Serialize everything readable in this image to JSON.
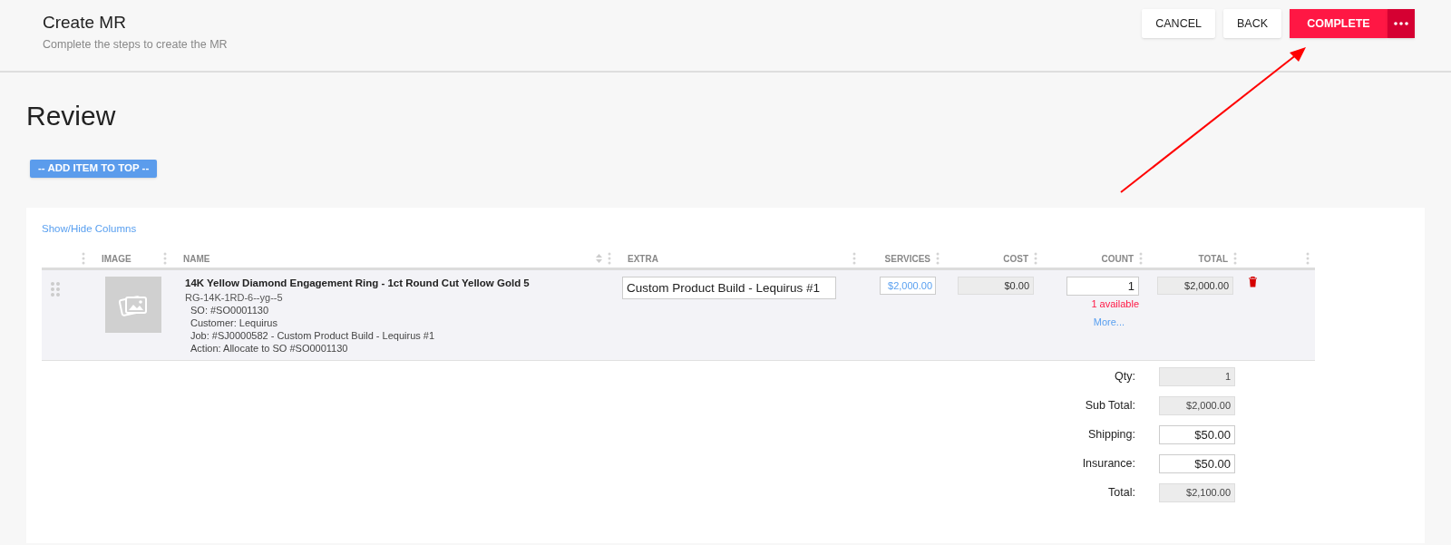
{
  "header": {
    "title": "Create MR",
    "subtitle": "Complete the steps to create the MR"
  },
  "actions": [
    {
      "label": "CANCEL",
      "kind": "plain"
    },
    {
      "label": "BACK",
      "kind": "plain"
    },
    {
      "label": "COMPLETE",
      "kind": "primary"
    }
  ],
  "section_title": "Review",
  "add_button": "-- ADD ITEM TO TOP --",
  "table": {
    "toggle_link": "Show/Hide Columns",
    "columns": [
      {
        "sortable": false
      },
      {
        "label": "IMAGE",
        "sortable": false
      },
      {
        "label": "NAME",
        "sortable": true
      },
      {
        "label": "EXTRA",
        "sortable": false
      },
      {
        "label": "SERVICES",
        "sortable": false
      },
      {
        "label": "COST",
        "sortable": false
      },
      {
        "label": "COUNT",
        "sortable": false
      },
      {
        "label": "TOTAL",
        "sortable": false
      },
      {
        "sortable": false
      }
    ],
    "rows": [
      {
        "name": "14K Yellow Diamond Engagement Ring - 1ct Round Cut Yellow Gold 5",
        "sku": "RG-14K-1RD-6--yg--5",
        "details": [
          "SO: #SO0001130",
          "Customer: Lequirus",
          "Job: #SJ0000582 - Custom Product Build - Lequirus #1",
          "Action: Allocate to SO #SO0001130"
        ],
        "extra": "Custom Product Build - Lequirus #1",
        "services": "$2,000.00",
        "cost": "$0.00",
        "count": "1",
        "availability": "1 available",
        "more_link": "More...",
        "total": "$2,000.00"
      }
    ]
  },
  "summary": [
    {
      "label": "Qty:",
      "value": "1",
      "disabled": true
    },
    {
      "label": "Sub Total:",
      "value": "$2,000.00",
      "disabled": true
    },
    {
      "label": "Shipping:",
      "value": "$50.00",
      "disabled": false
    },
    {
      "label": "Insurance:",
      "value": "$50.00",
      "disabled": false
    },
    {
      "label": "Total:",
      "value": "$2,100.00",
      "disabled": true
    }
  ]
}
